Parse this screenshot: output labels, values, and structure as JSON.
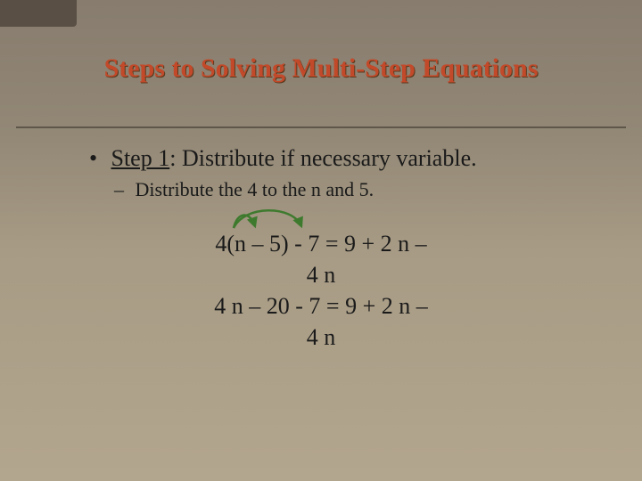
{
  "title": "Steps to Solving Multi-Step Equations",
  "bullet": {
    "dot": "•",
    "step_label": "Step 1",
    "step_after": ": Distribute if necessary variable."
  },
  "sub": {
    "dash": "–",
    "text": "Distribute the 4 to the n and 5."
  },
  "equation": {
    "line1": "4(n – 5) - 7 = 9 + 2 n –",
    "line2": "4 n",
    "line3": "4 n – 20 - 7 = 9 + 2 n –",
    "line4": "4 n"
  }
}
